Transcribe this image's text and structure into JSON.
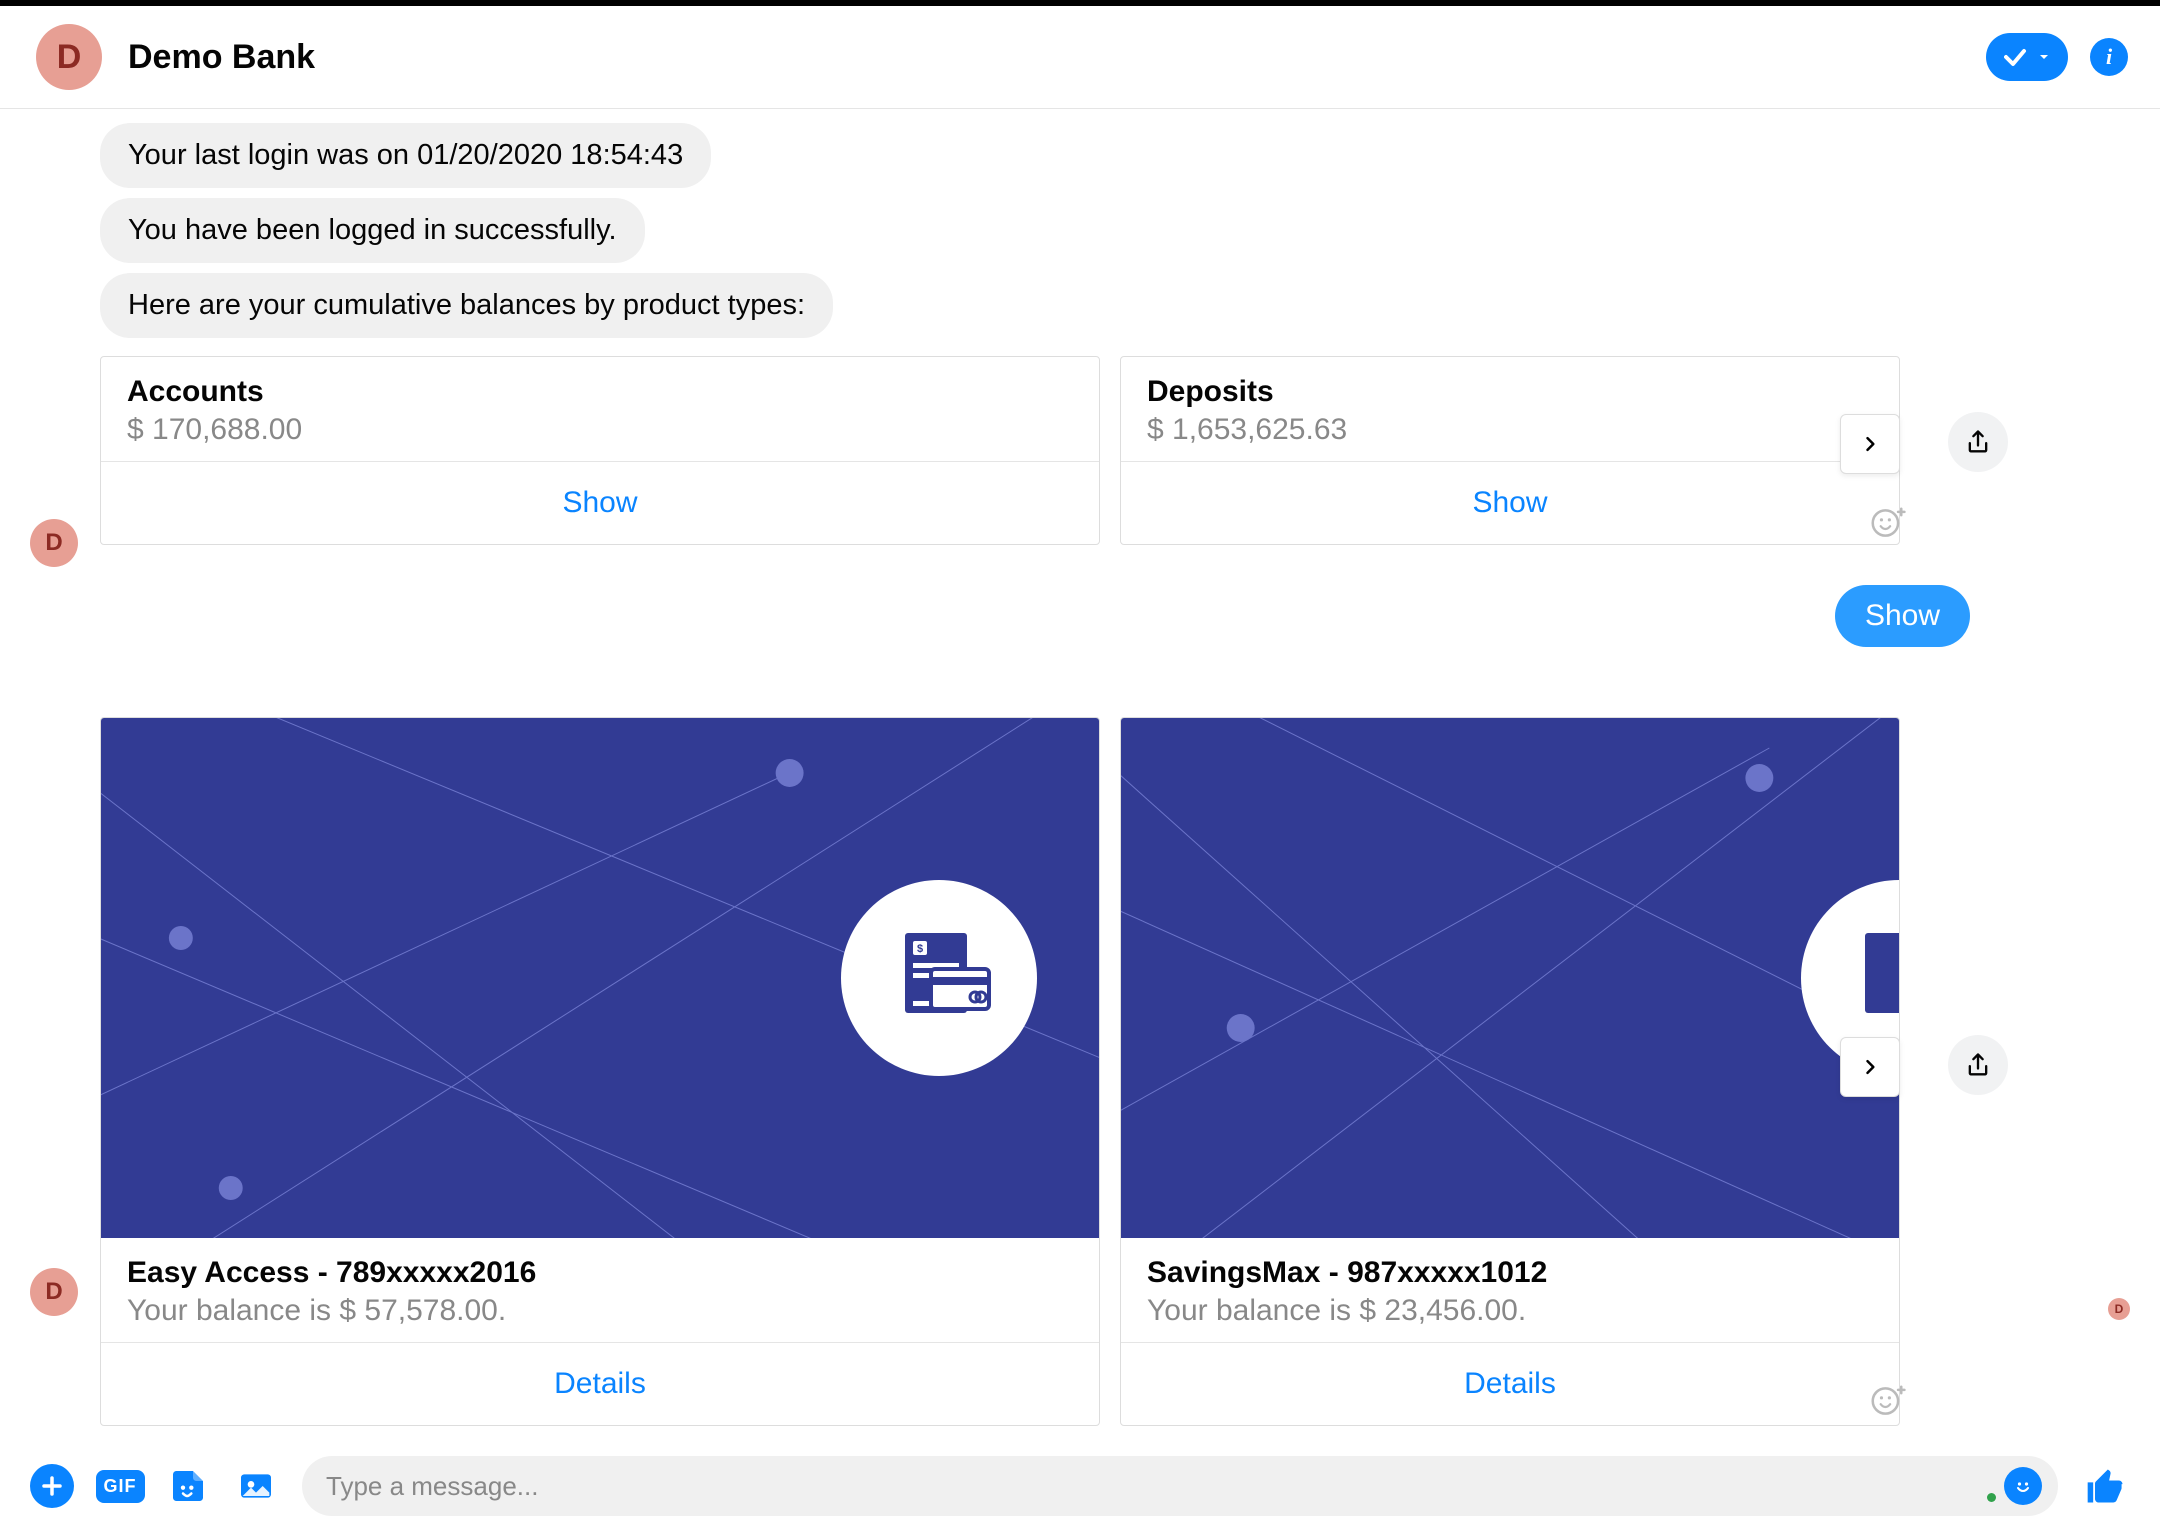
{
  "header": {
    "avatar_letter": "D",
    "title": "Demo Bank"
  },
  "messages": {
    "m0": "Your last login was on 01/20/2020 18:54:43",
    "m1": "You have been logged in successfully.",
    "m2": "Here are your cumulative balances by product types:"
  },
  "balances": [
    {
      "title": "Accounts",
      "amount": "$ 170,688.00",
      "action": "Show"
    },
    {
      "title": "Deposits",
      "amount": "$ 1,653,625.63",
      "action": "Show"
    }
  ],
  "user_reply": "Show",
  "products": [
    {
      "title": "Easy Access - 789xxxxx2016",
      "sub": "Your balance is $ 57,578.00.",
      "action": "Details"
    },
    {
      "title": "SavingsMax - 987xxxxx1012",
      "sub": "Your balance is $ 23,456.00.",
      "action": "Details"
    }
  ],
  "composer": {
    "placeholder": "Type a message...",
    "gif_label": "GIF"
  },
  "small_avatar_letter": "D"
}
